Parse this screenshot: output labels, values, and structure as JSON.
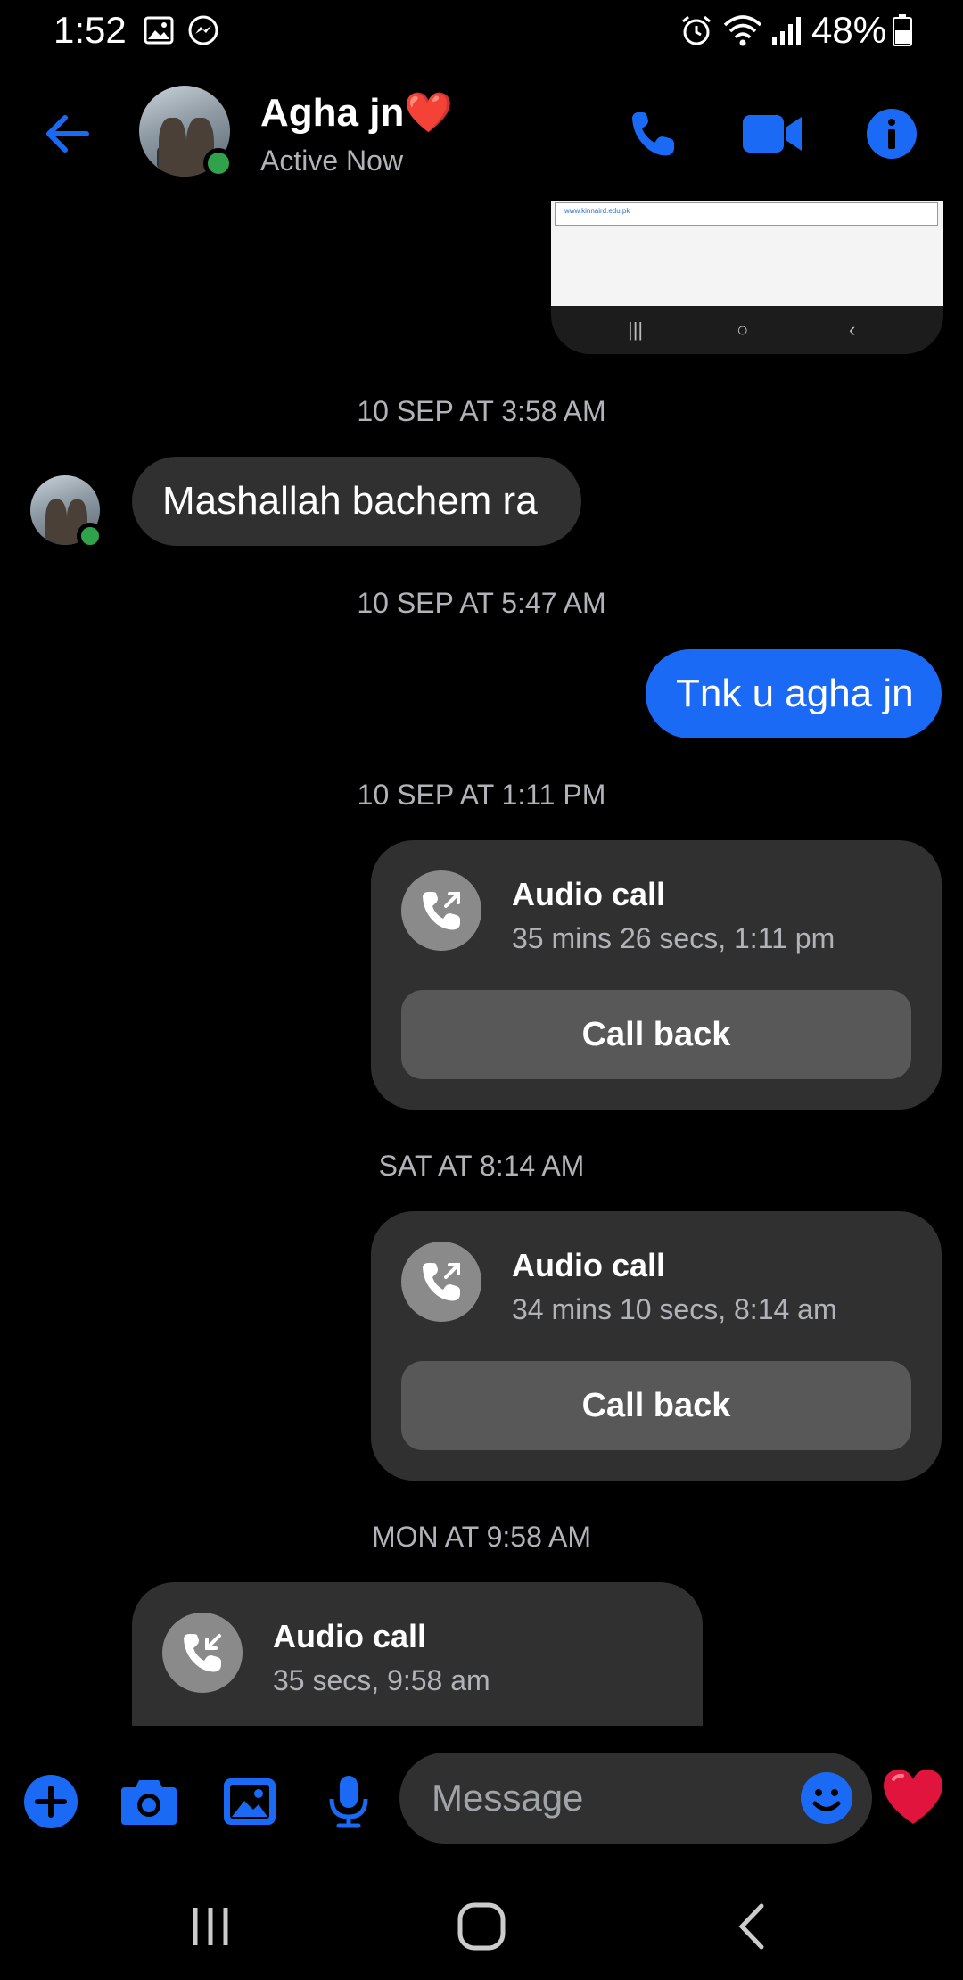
{
  "status_bar": {
    "time": "1:52",
    "battery": "48%",
    "icons": [
      "gallery-icon",
      "messenger-icon",
      "alarm-icon",
      "wifi-icon",
      "signal-icon",
      "battery-icon"
    ]
  },
  "header": {
    "contact_name": "Agha jn❤️",
    "contact_status": "Active Now",
    "icons": [
      "back-arrow-icon",
      "phone-icon",
      "video-camera-icon",
      "info-icon"
    ]
  },
  "screenshot_thumbnail": {
    "url_text": "www.kinnaird.edu.pk"
  },
  "messages": [
    {
      "type": "timestamp",
      "text": "10 SEP AT 3:58 AM"
    },
    {
      "type": "text",
      "direction": "incoming",
      "text": "Mashallah bachem  ra"
    },
    {
      "type": "timestamp",
      "text": "10 SEP AT 5:47 AM"
    },
    {
      "type": "text",
      "direction": "outgoing",
      "text": "Tnk u agha jn"
    },
    {
      "type": "timestamp",
      "text": "10 SEP AT 1:11 PM"
    },
    {
      "type": "call",
      "direction": "outgoing",
      "title": "Audio call",
      "detail": "35 mins 26 secs, 1:11 pm",
      "button": "Call back"
    },
    {
      "type": "timestamp",
      "text": "SAT AT 8:14 AM"
    },
    {
      "type": "call",
      "direction": "outgoing",
      "title": "Audio call",
      "detail": "34 mins 10 secs, 8:14 am",
      "button": "Call back"
    },
    {
      "type": "timestamp",
      "text": "MON AT 9:58 AM"
    },
    {
      "type": "call",
      "direction": "incoming",
      "title": "Audio call",
      "detail": "35 secs, 9:58 am"
    }
  ],
  "composer": {
    "placeholder": "Message",
    "icons": [
      "plus-icon",
      "camera-icon",
      "gallery-icon",
      "microphone-icon",
      "emoji-icon",
      "heart-icon"
    ]
  },
  "colors": {
    "accent": "#1a6af5",
    "background": "#000000",
    "bubble_incoming": "#303030",
    "online": "#31a24c",
    "heart": "#e0143c"
  }
}
